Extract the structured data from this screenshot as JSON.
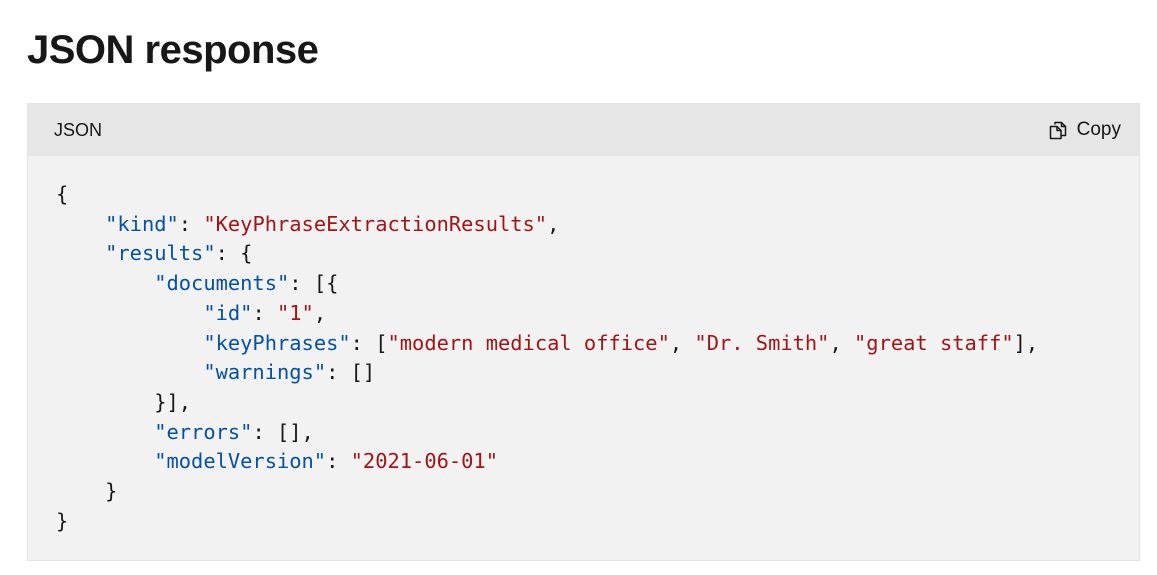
{
  "page": {
    "title": "JSON response"
  },
  "code_block": {
    "language": "JSON",
    "copy_label": "Copy",
    "lines": [
      [
        {
          "t": "p",
          "v": "{"
        }
      ],
      [
        {
          "t": "p",
          "v": "    "
        },
        {
          "t": "k",
          "v": "\"kind\""
        },
        {
          "t": "p",
          "v": ": "
        },
        {
          "t": "s",
          "v": "\"KeyPhraseExtractionResults\""
        },
        {
          "t": "p",
          "v": ","
        }
      ],
      [
        {
          "t": "p",
          "v": "    "
        },
        {
          "t": "k",
          "v": "\"results\""
        },
        {
          "t": "p",
          "v": ": {"
        }
      ],
      [
        {
          "t": "p",
          "v": "        "
        },
        {
          "t": "k",
          "v": "\"documents\""
        },
        {
          "t": "p",
          "v": ": [{"
        }
      ],
      [
        {
          "t": "p",
          "v": "            "
        },
        {
          "t": "k",
          "v": "\"id\""
        },
        {
          "t": "p",
          "v": ": "
        },
        {
          "t": "s",
          "v": "\"1\""
        },
        {
          "t": "p",
          "v": ","
        }
      ],
      [
        {
          "t": "p",
          "v": "            "
        },
        {
          "t": "k",
          "v": "\"keyPhrases\""
        },
        {
          "t": "p",
          "v": ": ["
        },
        {
          "t": "s",
          "v": "\"modern medical office\""
        },
        {
          "t": "p",
          "v": ", "
        },
        {
          "t": "s",
          "v": "\"Dr. Smith\""
        },
        {
          "t": "p",
          "v": ", "
        },
        {
          "t": "s",
          "v": "\"great staff\""
        },
        {
          "t": "p",
          "v": "],"
        }
      ],
      [
        {
          "t": "p",
          "v": "            "
        },
        {
          "t": "k",
          "v": "\"warnings\""
        },
        {
          "t": "p",
          "v": ": []"
        }
      ],
      [
        {
          "t": "p",
          "v": "        }],"
        }
      ],
      [
        {
          "t": "p",
          "v": "        "
        },
        {
          "t": "k",
          "v": "\"errors\""
        },
        {
          "t": "p",
          "v": ": [],"
        }
      ],
      [
        {
          "t": "p",
          "v": "        "
        },
        {
          "t": "k",
          "v": "\"modelVersion\""
        },
        {
          "t": "p",
          "v": ": "
        },
        {
          "t": "s",
          "v": "\"2021-06-01\""
        }
      ],
      [
        {
          "t": "p",
          "v": "    }"
        }
      ],
      [
        {
          "t": "p",
          "v": "}"
        }
      ]
    ]
  },
  "icons": {
    "copy": "copy-icon"
  },
  "colors": {
    "key": "#0451a5",
    "string": "#a31515",
    "punctuation": "#171717",
    "code_background": "#f2f2f2",
    "header_background": "#e6e6e6"
  }
}
